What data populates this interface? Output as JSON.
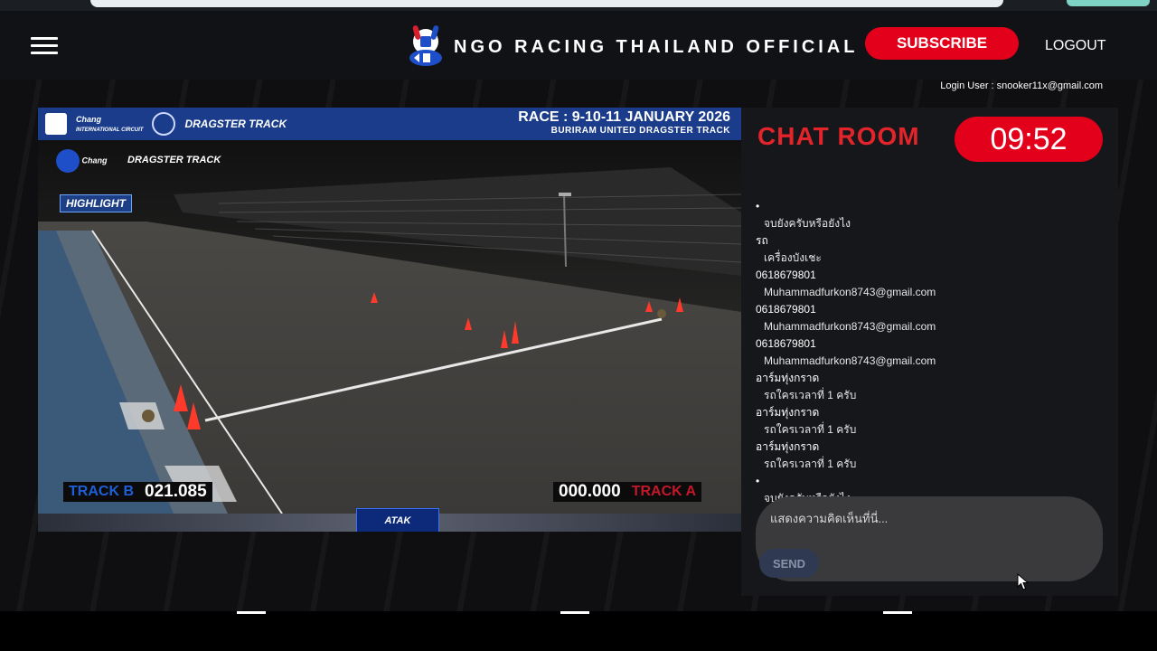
{
  "header": {
    "title": "NGO RACING THAILAND OFFICIAL",
    "subscribe_label": "SUBSCRIBE",
    "logout_label": "LOGOUT",
    "menu_icon": "hamburger-menu-icon"
  },
  "login_user": "Login User : snooker11x@gmail.com",
  "video": {
    "race_line1": "RACE : 9-10-11 JANUARY 2026",
    "race_line2": "BURIRAM UNITED DRAGSTER TRACK",
    "sponsor_chang": "Chang",
    "sponsor_circuit": "INTERNATIONAL CIRCUIT",
    "sponsor_dragster": "DRAGSTER TRACK",
    "highlight_label": "HIGHLIGHT",
    "track_b_label": "TRACK B",
    "track_b_time": "021.085",
    "track_a_label": "TRACK A",
    "track_a_time": "000.000",
    "atak_label": "ATAK"
  },
  "chat": {
    "title": "CHAT ROOM",
    "timer": "09:52",
    "messages": [
      {
        "name": "•",
        "text": "จบยังครับหรือยังไง"
      },
      {
        "name": "รถ",
        "text": "เครื่องบังเชะ"
      },
      {
        "name": "0618679801",
        "text": "Muhammadfurkon8743@gmail.com"
      },
      {
        "name": "0618679801",
        "text": "Muhammadfurkon8743@gmail.com"
      },
      {
        "name": "0618679801",
        "text": "Muhammadfurkon8743@gmail.com"
      },
      {
        "name": "อาร์มทุ่งกราด",
        "text": "รถใครเวลาที่ 1 ครับ"
      },
      {
        "name": "อาร์มทุ่งกราด",
        "text": "รถใครเวลาที่ 1 ครับ"
      },
      {
        "name": "อาร์มทุ่งกราด",
        "text": "รถใครเวลาที่ 1 ครับ"
      },
      {
        "name": "•",
        "text": "จบยังครับหรือยังไง"
      }
    ],
    "input_placeholder": "แสดงความคิดเห็นที่นี่...",
    "send_label": "SEND"
  },
  "colors": {
    "accent_red": "#e3001b",
    "chat_title_red": "#e3242b",
    "track_b_blue": "#1e5fd8",
    "track_a_red": "#c2182a"
  }
}
